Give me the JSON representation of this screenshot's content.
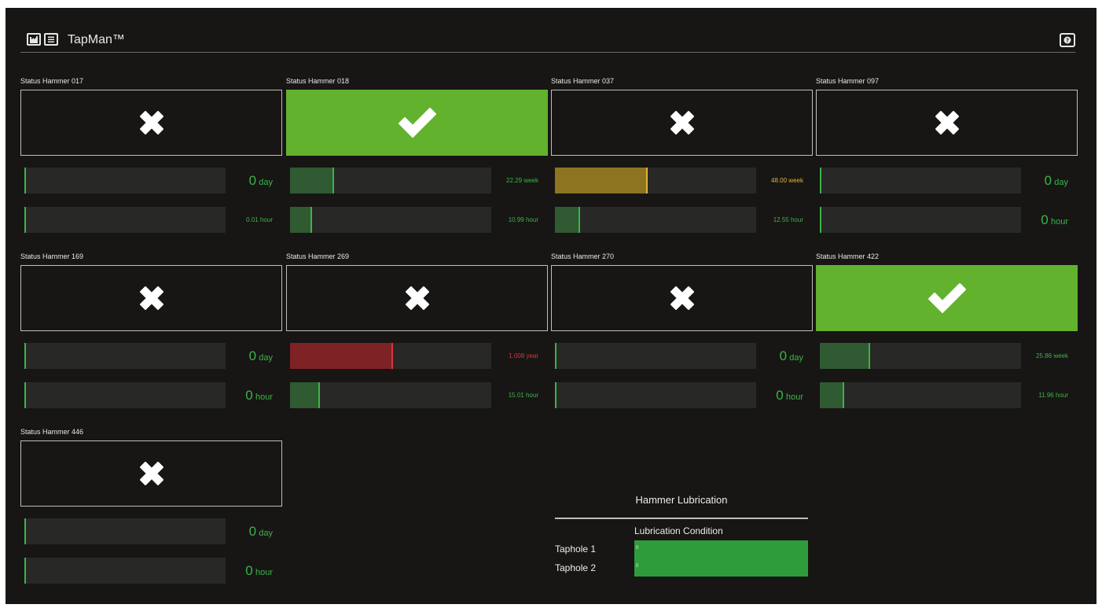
{
  "header": {
    "title": "TapMan™",
    "factory_icon": "factory-icon",
    "menu_icon": "menu-icon",
    "help_icon": "help-icon"
  },
  "colors": {
    "background": "#171614",
    "ok_green": "#62b22e",
    "value_green": "#3cb34a",
    "warn_yellow": "#e0b33a",
    "alarm_red": "#d9363b",
    "bar_green": "#2f5a32",
    "bar_yellow": "#8c7420",
    "bar_red": "#7e2226"
  },
  "hammers": [
    {
      "title": "Status Hammer 017",
      "status": "error",
      "meters": [
        {
          "fraction": 0,
          "value": "0",
          "unit": "day",
          "style": "big",
          "color": "green"
        },
        {
          "fraction": 0,
          "value": "0.01",
          "unit": "hour",
          "style": "small",
          "color": "green"
        }
      ]
    },
    {
      "title": "Status Hammer 018",
      "status": "ok",
      "meters": [
        {
          "fraction": 0.22,
          "value": "22.29",
          "unit": "week",
          "style": "small",
          "color": "green"
        },
        {
          "fraction": 0.11,
          "value": "10.99",
          "unit": "hour",
          "style": "small",
          "color": "green"
        }
      ]
    },
    {
      "title": "Status Hammer 037",
      "status": "error",
      "meters": [
        {
          "fraction": 0.46,
          "value": "48.00",
          "unit": "week",
          "style": "small",
          "color": "yellow"
        },
        {
          "fraction": 0.125,
          "value": "12.55",
          "unit": "hour",
          "style": "small",
          "color": "green"
        }
      ]
    },
    {
      "title": "Status Hammer 097",
      "status": "error",
      "meters": [
        {
          "fraction": 0,
          "value": "0",
          "unit": "day",
          "style": "big",
          "color": "green"
        },
        {
          "fraction": 0,
          "value": "0",
          "unit": "hour",
          "style": "big",
          "color": "green"
        }
      ]
    },
    {
      "title": "Status Hammer 169",
      "status": "error",
      "meters": [
        {
          "fraction": 0,
          "value": "0",
          "unit": "day",
          "style": "big",
          "color": "green"
        },
        {
          "fraction": 0,
          "value": "0",
          "unit": "hour",
          "style": "big",
          "color": "green"
        }
      ]
    },
    {
      "title": "Status Hammer 269",
      "status": "error",
      "meters": [
        {
          "fraction": 0.51,
          "value": "1.008",
          "unit": "year",
          "style": "small",
          "color": "red"
        },
        {
          "fraction": 0.15,
          "value": "15.01",
          "unit": "hour",
          "style": "small",
          "color": "green"
        }
      ]
    },
    {
      "title": "Status Hammer 270",
      "status": "error",
      "meters": [
        {
          "fraction": 0,
          "value": "0",
          "unit": "day",
          "style": "big",
          "color": "green"
        },
        {
          "fraction": 0,
          "value": "0",
          "unit": "hour",
          "style": "big",
          "color": "green"
        }
      ]
    },
    {
      "title": "Status Hammer 422",
      "status": "ok",
      "meters": [
        {
          "fraction": 0.25,
          "value": "25.86",
          "unit": "week",
          "style": "small",
          "color": "green"
        },
        {
          "fraction": 0.12,
          "value": "11.96",
          "unit": "hour",
          "style": "small",
          "color": "green"
        }
      ]
    },
    {
      "title": "Status Hammer 446",
      "status": "error",
      "meters": [
        {
          "fraction": 0,
          "value": "0",
          "unit": "day",
          "style": "big",
          "color": "green"
        },
        {
          "fraction": 0,
          "value": "0",
          "unit": "hour",
          "style": "big",
          "color": "green"
        }
      ]
    }
  ],
  "lubrication": {
    "title": "Hammer Lubrication",
    "column_header": "Lubrication Condition",
    "rows": [
      {
        "label": "Taphole 1",
        "value": "0",
        "fill": 1
      },
      {
        "label": "Taphole 2",
        "value": "0",
        "fill": 1
      }
    ]
  }
}
